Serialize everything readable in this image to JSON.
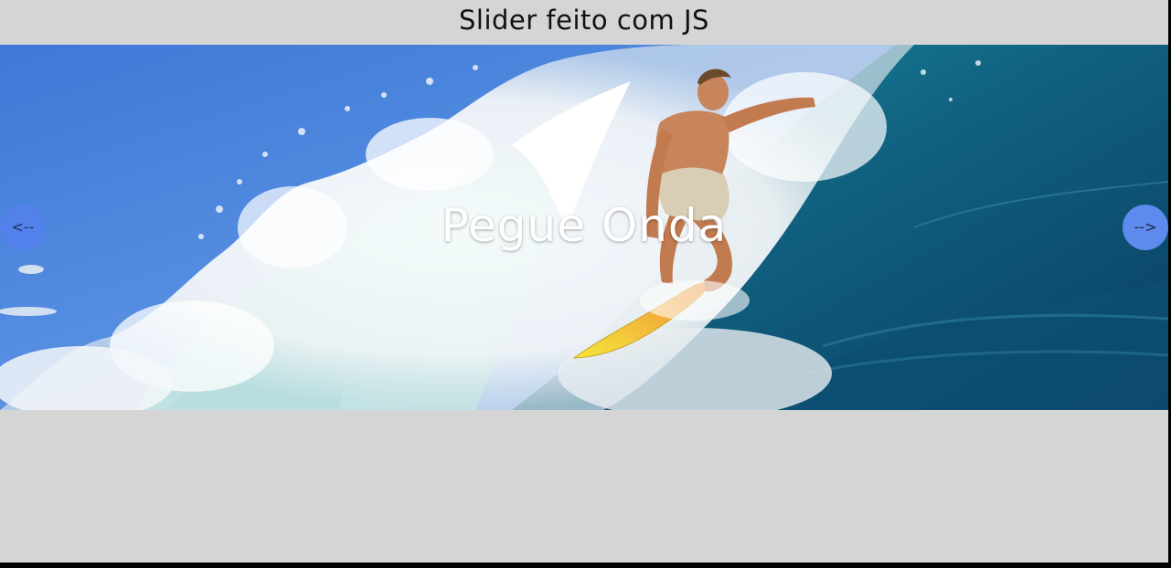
{
  "page": {
    "title": "Slider feito com JS"
  },
  "slider": {
    "caption": "Pegue Onda",
    "image_alt": "surfer riding a large wave",
    "prev_label": "<--",
    "next_label": "-->"
  },
  "colors": {
    "page_background": "#d5d5d5",
    "button_blue": "#5b87ef",
    "caption_text": "#ffffff",
    "outer_frame": "#000000"
  }
}
